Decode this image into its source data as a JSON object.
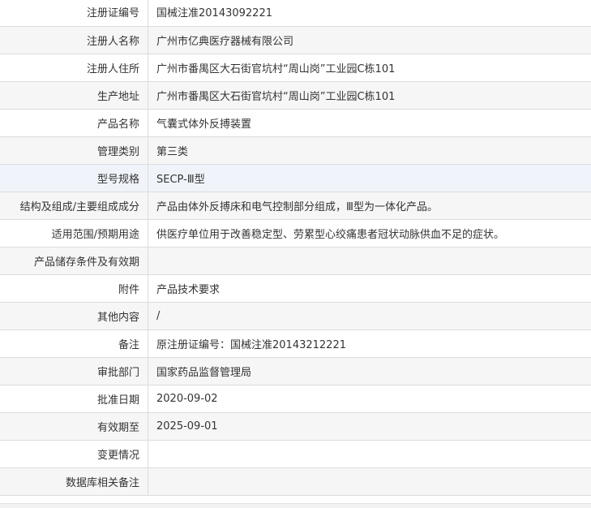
{
  "rows": [
    {
      "label": "注册证编号",
      "value": "国械注准20143092221"
    },
    {
      "label": "注册人名称",
      "value": "广州市亿典医疗器械有限公司"
    },
    {
      "label": "注册人住所",
      "value": "广州市番禺区大石街官坑村“周山岗”工业园C栋101"
    },
    {
      "label": "生产地址",
      "value": "广州市番禺区大石街官坑村“周山岗”工业园C栋101"
    },
    {
      "label": "产品名称",
      "value": "气囊式体外反搏装置"
    },
    {
      "label": "管理类别",
      "value": "第三类"
    },
    {
      "label": "型号规格",
      "value": "SECP-Ⅲ型"
    },
    {
      "label": "结构及组成/主要组成成分",
      "value": "产品由体外反搏床和电气控制部分组成，Ⅲ型为一体化产品。"
    },
    {
      "label": "适用范围/预期用途",
      "value": "供医疗单位用于改善稳定型、劳累型心绞痛患者冠状动脉供血不足的症状。"
    },
    {
      "label": "产品储存条件及有效期",
      "value": ""
    },
    {
      "label": "附件",
      "value": "产品技术要求"
    },
    {
      "label": "其他内容",
      "value": "/"
    },
    {
      "label": "备注",
      "value": "原注册证编号：国械注准20143212221"
    },
    {
      "label": "审批部门",
      "value": "国家药品监督管理局"
    },
    {
      "label": "批准日期",
      "value": "2020-09-02"
    },
    {
      "label": "有效期至",
      "value": "2025-09-01"
    },
    {
      "label": "变更情况",
      "value": ""
    },
    {
      "label": "数据库相关备注",
      "value": ""
    }
  ]
}
